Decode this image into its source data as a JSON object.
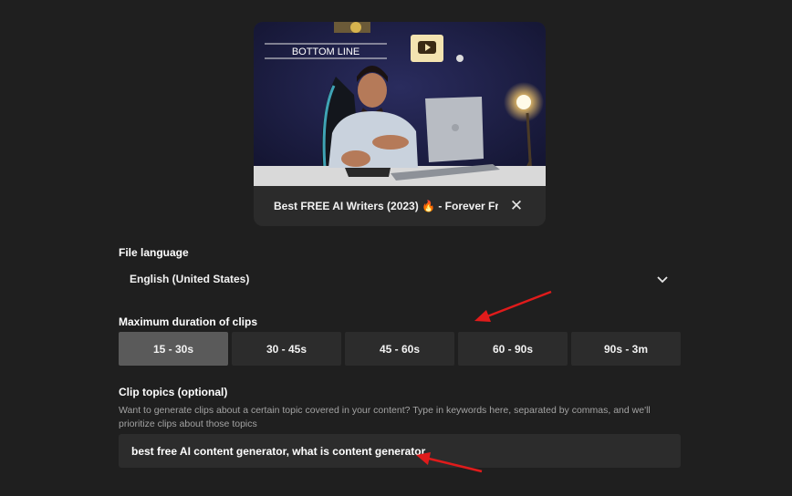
{
  "video": {
    "thumbnail_caption": "BOTTOM LINE",
    "title": "Best FREE AI Writers (2023) 🔥 - Forever Fr...",
    "close_icon": "close-icon"
  },
  "file_language": {
    "label": "File language",
    "value": "English (United States)",
    "icon": "chevron-down-icon"
  },
  "duration": {
    "label": "Maximum duration of clips",
    "options": [
      "15 - 30s",
      "30 - 45s",
      "45 - 60s",
      "60 - 90s",
      "90s - 3m"
    ],
    "selected": "15 - 30s"
  },
  "topics": {
    "label": "Clip topics (optional)",
    "help": "Want to generate clips about a certain topic covered in your content? Type in keywords here, separated by commas, and we'll prioritize clips about those topics",
    "value": "best free AI content generator, what is content generator"
  },
  "colors": {
    "background": "#1f1f1f",
    "button": "#2c2c2c",
    "selected_button": "#5a5a5a",
    "annotation_arrow": "#e01b1b"
  }
}
